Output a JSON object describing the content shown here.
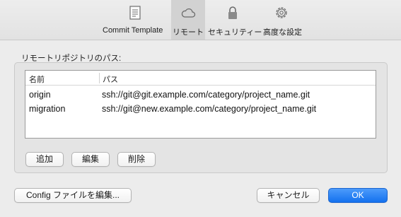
{
  "toolbar": {
    "tabs": [
      {
        "label": "Commit Template",
        "icon": "document-icon",
        "active": false
      },
      {
        "label": "リモート",
        "icon": "cloud-icon",
        "active": true
      },
      {
        "label": "セキュリティー",
        "icon": "lock-icon",
        "active": false
      },
      {
        "label": "高度な設定",
        "icon": "gear-icon",
        "active": false
      }
    ]
  },
  "remotes": {
    "section_label": "リモートリポジトリのパス:",
    "columns": [
      "名前",
      "パス"
    ],
    "rows": [
      {
        "name": "origin",
        "path": "ssh://git@git.example.com/category/project_name.git"
      },
      {
        "name": "migration",
        "path": "ssh://git@new.example.com/category/project_name.git"
      }
    ],
    "add_label": "追加",
    "edit_label": "編集",
    "delete_label": "削除"
  },
  "footer": {
    "config_label": "Config ファイルを編集...",
    "cancel_label": "キャンセル",
    "ok_label": "OK"
  },
  "colors": {
    "accent": "#1471ee",
    "active_tab": "#d2d2d2",
    "window_bg": "#ececec"
  }
}
